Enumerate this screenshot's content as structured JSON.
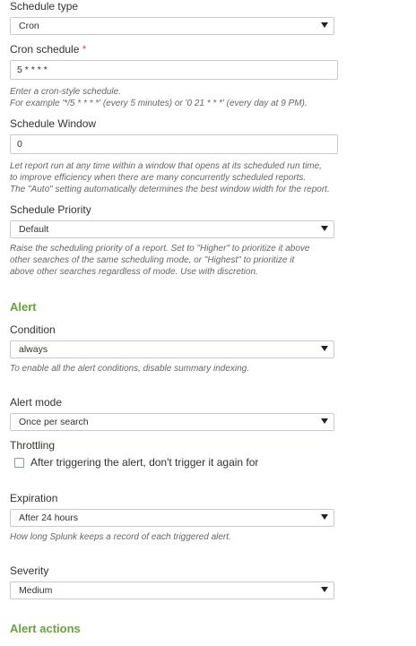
{
  "schedule_type": {
    "label": "Schedule type",
    "value": "Cron"
  },
  "cron_schedule": {
    "label": "Cron schedule",
    "required_mark": "*",
    "value": "5 * * * *",
    "help_line1": "Enter a cron-style schedule.",
    "help_line2": "For example '*/5 * * * *' (every 5 minutes) or '0 21 * * *' (every day at 9 PM)."
  },
  "schedule_window": {
    "label": "Schedule Window",
    "value": "0",
    "help_line1": "Let report run at any time within a window that opens at its scheduled run time,",
    "help_line2": "to improve efficiency when there are many concurrently scheduled reports.",
    "help_line3": "The \"Auto\" setting automatically determines the best window width for the report."
  },
  "schedule_priority": {
    "label": "Schedule Priority",
    "value": "Default",
    "help_line1": "Raise the scheduling priority of a report. Set to \"Higher\" to prioritize it above",
    "help_line2": "other searches of the same scheduling mode, or \"Highest\" to prioritize it",
    "help_line3": "above other searches regardless of mode. Use with discretion."
  },
  "alert_section": {
    "title": "Alert"
  },
  "condition": {
    "label": "Condition",
    "value": "always",
    "help": "To enable all the alert conditions, disable summary indexing."
  },
  "alert_mode": {
    "label": "Alert mode",
    "value": "Once per search"
  },
  "throttling": {
    "label": "Throttling",
    "checkbox_label": "After triggering the alert, don't trigger it again for",
    "checked": false
  },
  "expiration": {
    "label": "Expiration",
    "value": "After 24 hours",
    "help": "How long Splunk keeps a record of each triggered alert."
  },
  "severity": {
    "label": "Severity",
    "value": "Medium"
  },
  "alert_actions_section": {
    "title": "Alert actions"
  },
  "colors": {
    "section_green": "#65a637",
    "required_red": "#d9534f"
  }
}
